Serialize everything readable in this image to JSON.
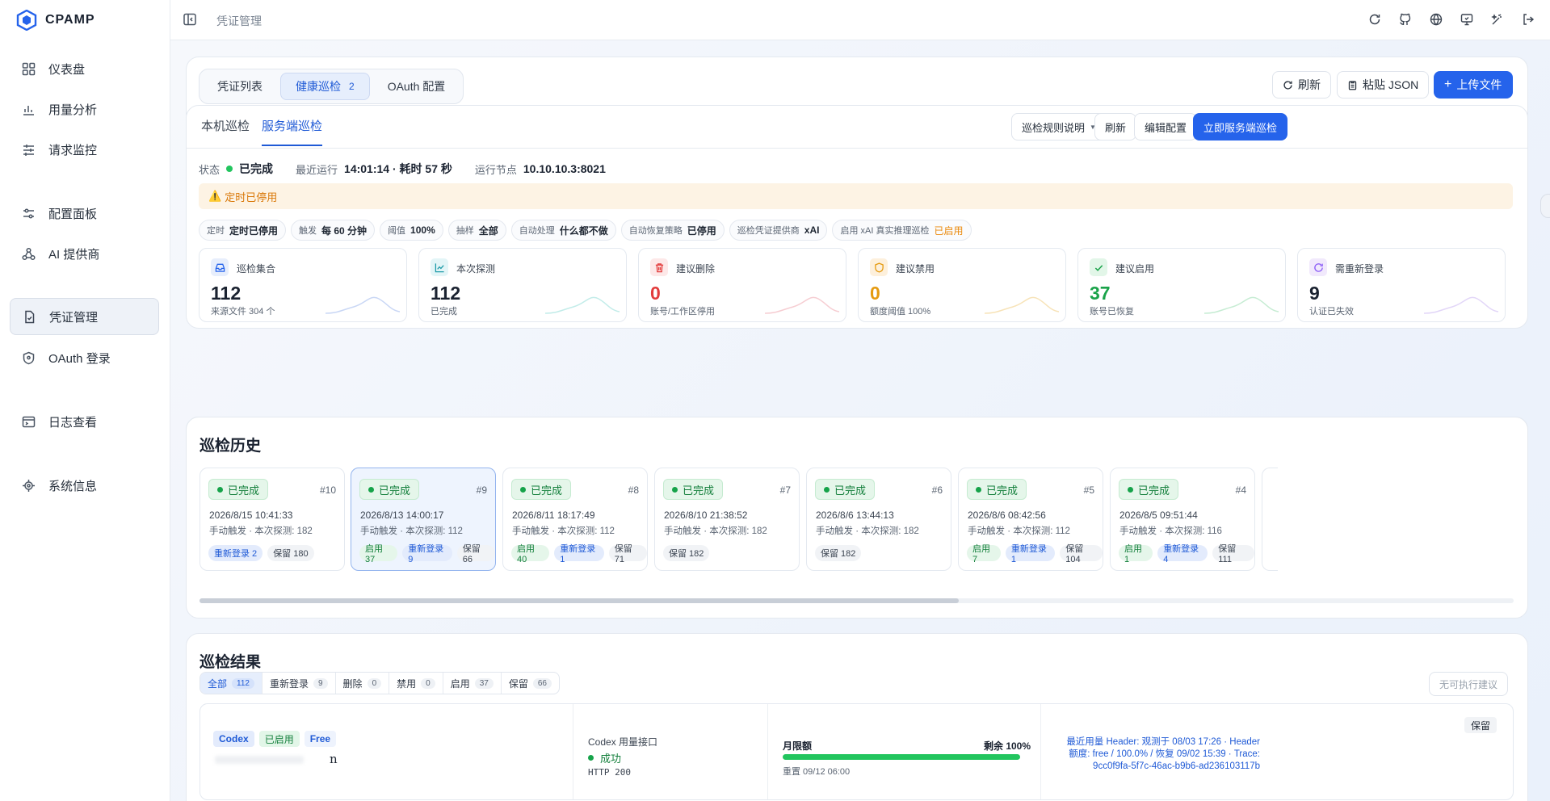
{
  "app": {
    "name": "CPAMP"
  },
  "nav": {
    "items": [
      {
        "label": "仪表盘"
      },
      {
        "label": "用量分析"
      },
      {
        "label": "请求监控"
      },
      {
        "label": "配置面板"
      },
      {
        "label": "AI 提供商"
      },
      {
        "label": "凭证管理"
      },
      {
        "label": "OAuth 登录"
      },
      {
        "label": "日志查看"
      },
      {
        "label": "系统信息"
      }
    ]
  },
  "header": {
    "breadcrumb": "凭证管理"
  },
  "segment": {
    "tabs": [
      {
        "label": "凭证列表"
      },
      {
        "label": "健康巡检",
        "count": "2"
      },
      {
        "label": "OAuth 配置"
      }
    ]
  },
  "toolbar": {
    "refresh": "刷新",
    "paste_json": "粘贴 JSON",
    "upload": "上传文件"
  },
  "inspection": {
    "tabs": [
      {
        "label": "本机巡检"
      },
      {
        "label": "服务端巡检"
      }
    ],
    "rules_button": "巡检规则说明",
    "refresh": "刷新",
    "edit_config": "编辑配置",
    "run_now": "立即服务端巡检",
    "status_label": "状态",
    "status_value": "已完成",
    "last_run_label": "最近运行",
    "last_run_value": "14:01:14 · 耗时 57 秒",
    "node_label": "运行节点",
    "node_value": "10.10.10.3:8021",
    "warning": "定时已停用",
    "chips": [
      {
        "k": "定时",
        "v": "定时已停用"
      },
      {
        "k": "触发",
        "v": "每 60 分钟"
      },
      {
        "k": "阈值",
        "v": "100%"
      },
      {
        "k": "抽样",
        "v": "全部"
      },
      {
        "k": "自动处理",
        "v": "什么都不做"
      },
      {
        "k": "自动恢复策略",
        "v": "已停用"
      },
      {
        "k": "巡检凭证提供商",
        "v": "xAI"
      },
      {
        "k": "启用 xAI 真实推理巡检",
        "v": "已启用"
      }
    ],
    "stats": [
      {
        "label": "巡检集合",
        "value": "112",
        "sub": "来源文件 304 个",
        "color": "#1a2230"
      },
      {
        "label": "本次探测",
        "value": "112",
        "sub": "已完成",
        "color": "#1a2230"
      },
      {
        "label": "建议删除",
        "value": "0",
        "sub": "账号/工作区停用",
        "color": "#e23b3b"
      },
      {
        "label": "建议禁用",
        "value": "0",
        "sub": "额度阈值 100%",
        "color": "#e59a0f"
      },
      {
        "label": "建议启用",
        "value": "37",
        "sub": "账号已恢复",
        "color": "#1aa34a"
      },
      {
        "label": "需重新登录",
        "value": "9",
        "sub": "认证已失效",
        "color": "#1a2230"
      }
    ]
  },
  "history": {
    "title": "巡检历史",
    "runs": [
      {
        "status": "已完成",
        "num": "#10",
        "date": "2026/8/15 10:41:33",
        "desc": "手动触发 · 本次探测: 182",
        "tags": [
          {
            "t": "重新登录 2",
            "c": "b"
          },
          {
            "t": "保留 180",
            "c": "n"
          }
        ]
      },
      {
        "status": "已完成",
        "num": "#9",
        "date": "2026/8/13 14:00:17",
        "desc": "手动触发 · 本次探测: 112",
        "tags": [
          {
            "t": "启用 37",
            "c": "g"
          },
          {
            "t": "重新登录 9",
            "c": "b"
          },
          {
            "t": "保留 66",
            "c": "n"
          }
        ]
      },
      {
        "status": "已完成",
        "num": "#8",
        "date": "2026/8/11 18:17:49",
        "desc": "手动触发 · 本次探测: 112",
        "tags": [
          {
            "t": "启用 40",
            "c": "g"
          },
          {
            "t": "重新登录 1",
            "c": "b"
          },
          {
            "t": "保留 71",
            "c": "n"
          }
        ]
      },
      {
        "status": "已完成",
        "num": "#7",
        "date": "2026/8/10 21:38:52",
        "desc": "手动触发 · 本次探测: 182",
        "tags": [
          {
            "t": "保留 182",
            "c": "n"
          }
        ]
      },
      {
        "status": "已完成",
        "num": "#6",
        "date": "2026/8/6 13:44:13",
        "desc": "手动触发 · 本次探测: 182",
        "tags": [
          {
            "t": "保留 182",
            "c": "n"
          }
        ]
      },
      {
        "status": "已完成",
        "num": "#5",
        "date": "2026/8/6 08:42:56",
        "desc": "手动触发 · 本次探测: 112",
        "tags": [
          {
            "t": "启用 7",
            "c": "g"
          },
          {
            "t": "重新登录 1",
            "c": "b"
          },
          {
            "t": "保留 104",
            "c": "n"
          }
        ]
      },
      {
        "status": "已完成",
        "num": "#4",
        "date": "2026/8/5 09:51:44",
        "desc": "手动触发 · 本次探测: 116",
        "tags": [
          {
            "t": "启用 1",
            "c": "g"
          },
          {
            "t": "重新登录 4",
            "c": "b"
          },
          {
            "t": "保留 111",
            "c": "n"
          }
        ]
      }
    ]
  },
  "results": {
    "title": "巡检结果",
    "filters": [
      {
        "label": "全部",
        "count": "112"
      },
      {
        "label": "重新登录",
        "count": "9"
      },
      {
        "label": "删除",
        "count": "0"
      },
      {
        "label": "禁用",
        "count": "0"
      },
      {
        "label": "启用",
        "count": "37"
      },
      {
        "label": "保留",
        "count": "66"
      }
    ],
    "no_action": "无可执行建议",
    "row": {
      "tags": [
        "Codex",
        "已启用",
        "Free"
      ],
      "name_fragment": "n",
      "api_label": "Codex 用量接口",
      "api_status": "成功",
      "http": "HTTP 200",
      "quota_label": "月限额",
      "remaining": "剩余 100%",
      "remaining_pct": 100,
      "reset": "重置 09/12 06:00",
      "decision": "保留",
      "details": "最近用量 Header: 观测于 08/03 17:26 · Header 额度: free / 100.0% / 恢复 09/02 15:39 · Trace: 9cc0f9fa-5f7c-46ac-b9b6-ad236103117b"
    }
  }
}
